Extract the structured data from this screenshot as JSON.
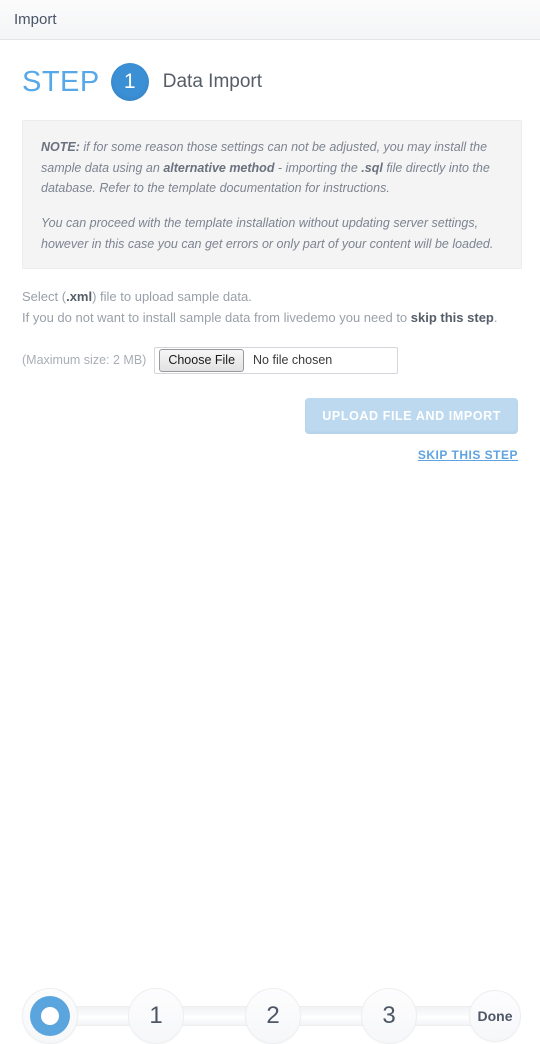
{
  "window": {
    "title": "Import"
  },
  "heading": {
    "step_word": "STEP",
    "step_number": "1",
    "step_title": "Data Import"
  },
  "note": {
    "paragraph1_prefix": "NOTE:",
    "paragraph1_part1": " if for some reason those settings can not be adjusted, you may install the sample data using an ",
    "paragraph1_bold1": "alternative method",
    "paragraph1_part2": " - importing the ",
    "paragraph1_bold2": ".sql",
    "paragraph1_part3": " file directly into the database. Refer to the template documentation for instructions.",
    "paragraph2": "You can proceed with the template installation without updating server settings, however in this case you can get errors or only part of your content will be loaded."
  },
  "select_block": {
    "line1_part1": "Select (",
    "line1_bold": ".xml",
    "line1_part2": ") file to upload sample data.",
    "line2_part1": "If you do not want to install sample data from livedemo you need to ",
    "line2_bold": "skip this step",
    "line2_part2": "."
  },
  "file_upload": {
    "max_size_label": "(Maximum size: 2 MB)",
    "choose_file_label": "Choose File",
    "file_name_value": "No file chosen"
  },
  "actions": {
    "upload_button_label": "UPLOAD FILE AND IMPORT",
    "skip_link_label": "SKIP THIS STEP"
  },
  "steps_indicator": {
    "nodes": [
      {
        "label": "",
        "type": "ring",
        "state": "active"
      },
      {
        "label": "1",
        "type": "number",
        "state": "pending"
      },
      {
        "label": "2",
        "type": "number",
        "state": "pending"
      },
      {
        "label": "3",
        "type": "number",
        "state": "pending"
      },
      {
        "label": "Done",
        "type": "text",
        "state": "pending"
      }
    ]
  },
  "colors": {
    "accent_blue": "#57a8e8",
    "badge_blue": "#3b8fd4",
    "button_blue": "#bcd9f0",
    "link_blue": "#5fa3e0",
    "note_bg": "#f4f4f5",
    "text_gray": "#57606a"
  }
}
